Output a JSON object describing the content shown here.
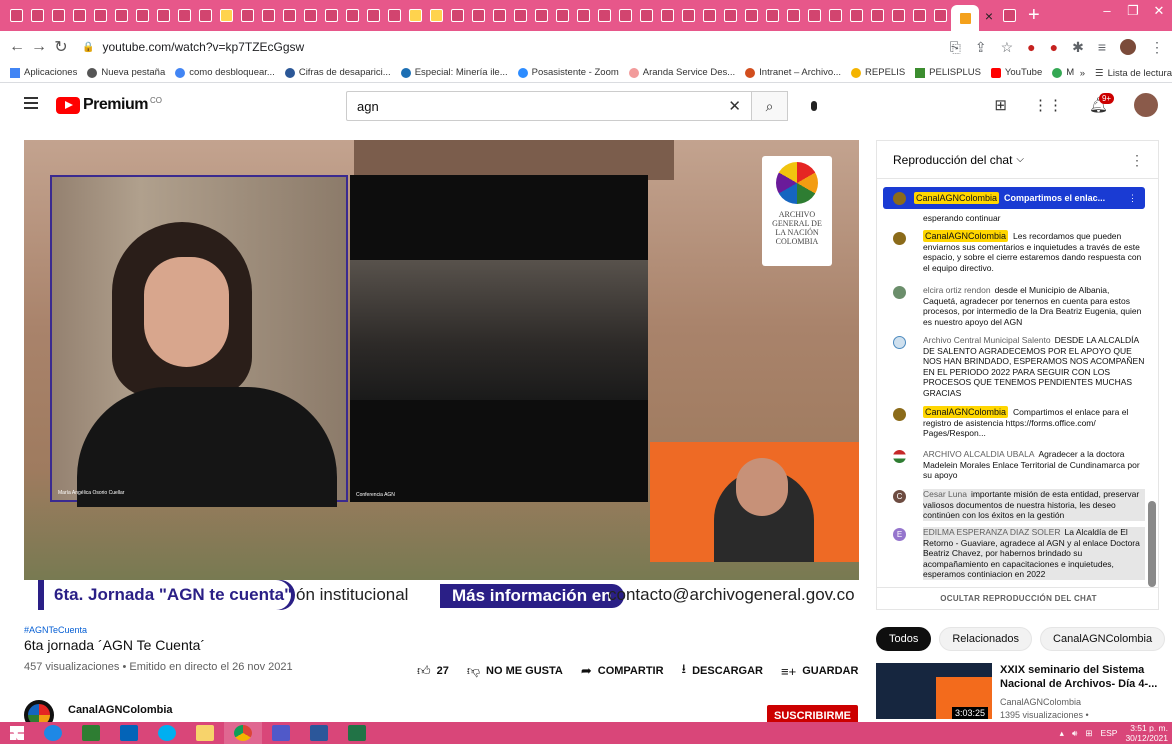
{
  "browser": {
    "url": "youtube.com/watch?v=kp7TZEcGgsw",
    "tab_close": "×",
    "new_tab": "+",
    "bookmarks": [
      {
        "label": "Aplicaciones",
        "color": "#4285f4"
      },
      {
        "label": "Nueva pestaña",
        "color": "#555555"
      },
      {
        "label": "como desbloquear...",
        "color": "#4285f4"
      },
      {
        "label": "Cifras de desaparici...",
        "color": "#2b5797"
      },
      {
        "label": "Especial: Minería ile...",
        "color": "#1c6fb4"
      },
      {
        "label": "Posasistente - Zoom",
        "color": "#2d8cff"
      },
      {
        "label": "Aranda Service Des...",
        "color": "#f29b9b"
      },
      {
        "label": "Intranet – Archivo...",
        "color": "#d24e1e"
      },
      {
        "label": "REPELIS",
        "color": "#f4b400"
      },
      {
        "label": "PELISPLUS",
        "color": "#3c8d2f"
      },
      {
        "label": "YouTube",
        "color": "#ff0000"
      },
      {
        "label": "Maps",
        "color": "#34a853"
      }
    ],
    "bookmarks_more": "»",
    "reading_list": "Lista de lectura"
  },
  "yt": {
    "logo_text": "Premium",
    "logo_sup": "CO",
    "search_value": "agn",
    "notif_count": "9+"
  },
  "video": {
    "overlay_title": "6ta. Jornada \"AGN te cuenta\"",
    "overlay_ticker": "ón institucional",
    "overlay_more": "Más información en",
    "overlay_contact": "contacto@archivogeneral.gov.co",
    "cam1_caption": "María Angélica Osorio Cuellar",
    "cam2_caption": "Conferencia AGN",
    "agn_logo": "ARCHIVO GENERAL DE LA NACIÓN COLOMBIA",
    "hashtag": "#AGNTeCuenta",
    "title": "6ta jornada ´AGN Te Cuenta´",
    "meta": "457 visualizaciones • Emitido en directo el 26 nov 2021",
    "likes": "27",
    "dislike": "NO ME GUSTA",
    "share": "COMPARTIR",
    "download": "DESCARGAR",
    "save": "GUARDAR",
    "more": "···",
    "channel": "CanalAGNColombia",
    "subscribe": "SUSCRIBIRME"
  },
  "chat": {
    "header": "Reproducción del chat",
    "pinned_author": "CanalAGNColombia",
    "pinned_text": "Compartimos el enlac...",
    "partial_text": "esperando continuar",
    "messages": [
      {
        "author": "CanalAGNColombia",
        "highlight": true,
        "text": "Les recordamos que pueden enviarnos sus comentarios e inquietudes a través de este espacio, y sobre el cierre estaremos dando respuesta con el equipo directivo.",
        "color": "#8b6b1a"
      },
      {
        "author": "elcira ortiz rendon",
        "highlight": false,
        "text": "desde el Municipio de Albania, Caquetá, agradecer por tenernos en cuenta para estos procesos, por intermedio de la Dra Beatriz Eugenia, quien es nuestro apoyo del AGN",
        "color": "#6b8e6b"
      },
      {
        "author": "Archivo Central Municipal Salento",
        "highlight": false,
        "text": "DESDE LA ALCALDÍA DE SALENTO AGRADECEMOS POR EL APOYO QUE NOS HAN BRINDADO, ESPERAMOS NOS ACOMPAÑEN EN EL PERIODO 2022 PARA SEGUIR CON LOS PROCESOS QUE TENEMOS PENDIENTES MUCHAS GRACIAS",
        "color": "#4d8bbf"
      },
      {
        "author": "CanalAGNColombia",
        "highlight": true,
        "text": "Compartimos el enlace para el registro de asistencia https://forms.office.com/ Pages/Respon...",
        "color": "#8b6b1a"
      },
      {
        "author": "ARCHIVO ALCALDIA UBALA",
        "highlight": false,
        "text": "Agradecer a la doctora Madelein Morales Enlace Territorial de Cundinamarca por su apoyo",
        "color": "#2e7d32"
      },
      {
        "author": "Cesar Luna",
        "highlight": false,
        "text": "importante misión de esta entidad, preservar valiosos documentos de nuestra historia, les deseo continúen con los éxitos en la gestión",
        "color": "#6d4c41",
        "grey": true,
        "initial": "C"
      },
      {
        "author": "EDILMA ESPERANZA DIAZ SOLER",
        "highlight": false,
        "text": "La Alcaldía de El Retorno - Guaviare, agradece al AGN y al enlace Doctora Beatriz Chavez, por habernos brindado su acompañamiento en capacitaciones e inquietudes, esperamos continiacion en 2022",
        "color": "#9575cd",
        "grey": true,
        "initial": "E"
      }
    ],
    "footer": "OCULTAR REPRODUCCIÓN DEL CHAT"
  },
  "related": {
    "chips": [
      "Todos",
      "Relacionados",
      "CanalAGNColombia"
    ],
    "title": "XXIX seminario del Sistema Nacional de Archivos- Día 4-...",
    "channel": "CanalAGNColombia",
    "views": "1395 visualizaciones •",
    "duration": "3:03:25"
  },
  "taskbar": {
    "lang": "ESP",
    "time": "3:51 p. m.",
    "date": "30/12/2021"
  }
}
